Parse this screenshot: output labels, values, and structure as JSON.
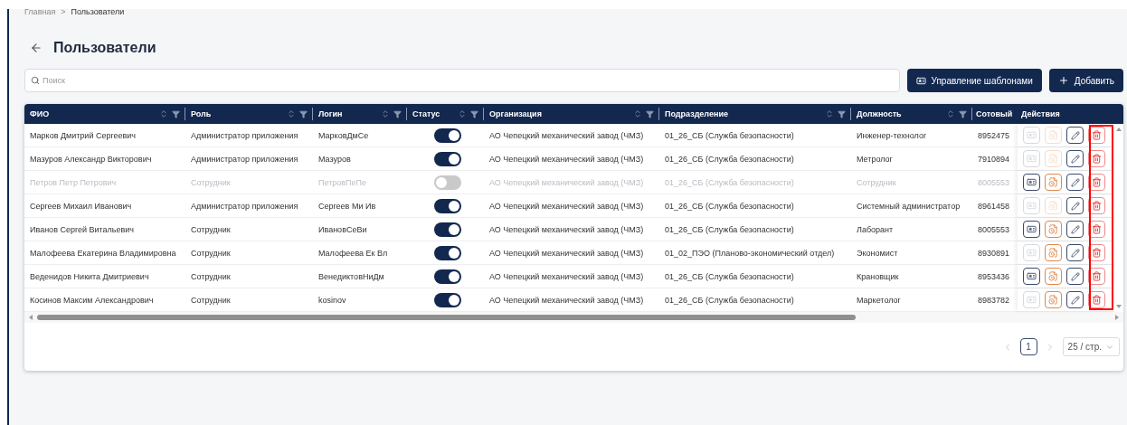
{
  "breadcrumb": [
    "Главная",
    "Пользователи"
  ],
  "breadcrumb_separator": ">",
  "title": "Пользователи",
  "search": {
    "placeholder": "Поиск"
  },
  "buttons": [
    {
      "kind": "template",
      "label": "Управление шаблонами"
    },
    {
      "kind": "add",
      "label": "Добавить"
    }
  ],
  "table": {
    "columns": [
      {
        "label": "ФИО",
        "sortable": true
      },
      {
        "label": "Роль",
        "sortable": true
      },
      {
        "label": "Логин",
        "sortable": true
      },
      {
        "label": "Статус",
        "sortable": true
      },
      {
        "label": "Организация",
        "sortable": true
      },
      {
        "label": "Подразделение",
        "sortable": true
      },
      {
        "label": "Должность",
        "sortable": true
      },
      {
        "label": "Сотовый",
        "sortable": false
      },
      {
        "label": "Действия",
        "sortable": false
      }
    ],
    "delete_column_highlighted": true,
    "rows": [
      {
        "name": "Марков Дмитрий Сергеевич",
        "role": "Администратор приложения",
        "login": "МарковДмСе",
        "on": true,
        "organization": "АО Чепецкий механический завод (ЧМЗ)",
        "department": "01_26_СБ (Служба безопасности)",
        "position": "Инженер-технолог",
        "phone": "8952475",
        "card_enabled": false,
        "doc_enabled": false
      },
      {
        "name": "Мазуров Александр Викторович",
        "role": "Администратор приложения",
        "login": "Мазуров",
        "on": true,
        "organization": "АО Чепецкий механический завод (ЧМЗ)",
        "department": "01_26_СБ (Служба безопасности)",
        "position": "Метролог",
        "phone": "7910894",
        "card_enabled": false,
        "doc_enabled": false
      },
      {
        "name": "Петров Петр Петрович",
        "role": "Сотрудник",
        "login": "ПетровПеПе",
        "on": false,
        "organization": "АО Чепецкий механический завод (ЧМЗ)",
        "department": "01_26_СБ (Служба безопасности)",
        "position": "Сотрудник",
        "phone": "8005553",
        "card_enabled": true,
        "doc_enabled": true
      },
      {
        "name": "Сергеев Михаил Иванович",
        "role": "Администратор приложения",
        "login": "Сергеев Ми Ив",
        "on": true,
        "organization": "АО Чепецкий механический завод (ЧМЗ)",
        "department": "01_26_СБ (Служба безопасности)",
        "position": "Системный администратор",
        "phone": "8961458",
        "card_enabled": false,
        "doc_enabled": false
      },
      {
        "name": "Иванов Сергей Витальевич",
        "role": "Сотрудник",
        "login": "ИвановСеВи",
        "on": true,
        "organization": "АО Чепецкий механический завод (ЧМЗ)",
        "department": "01_26_СБ (Служба безопасности)",
        "position": "Лаборант",
        "phone": "8005553",
        "card_enabled": true,
        "doc_enabled": true
      },
      {
        "name": "Малофеева Екатерина Владимировна",
        "role": "Сотрудник",
        "login": "Малофеева Ек Вл",
        "on": true,
        "organization": "АО Чепецкий механический завод (ЧМЗ)",
        "department": "01_02_ПЭО (Планово-экономический отдел)",
        "position": "Экономист",
        "phone": "8930891",
        "card_enabled": false,
        "doc_enabled": true
      },
      {
        "name": "Веденидов Никита Дмитриевич",
        "role": "Сотрудник",
        "login": "ВенедиктовНиДм",
        "on": true,
        "organization": "АО Чепецкий механический завод (ЧМЗ)",
        "department": "01_26_СБ (Служба безопасности)",
        "position": "Крановщик",
        "phone": "8953436",
        "card_enabled": true,
        "doc_enabled": true
      },
      {
        "name": "Косинов Максим Александрович",
        "role": "Сотрудник",
        "login": "kosinov",
        "on": true,
        "organization": "АО Чепецкий механический завод (ЧМЗ)",
        "department": "01_26_СБ (Служба безопасности)",
        "position": "Маркетолог",
        "phone": "8983782",
        "card_enabled": false,
        "doc_enabled": true
      }
    ]
  },
  "pagination": {
    "pages": [
      {
        "label": "1",
        "selected": true
      }
    ],
    "page_size": "25 / стр."
  }
}
